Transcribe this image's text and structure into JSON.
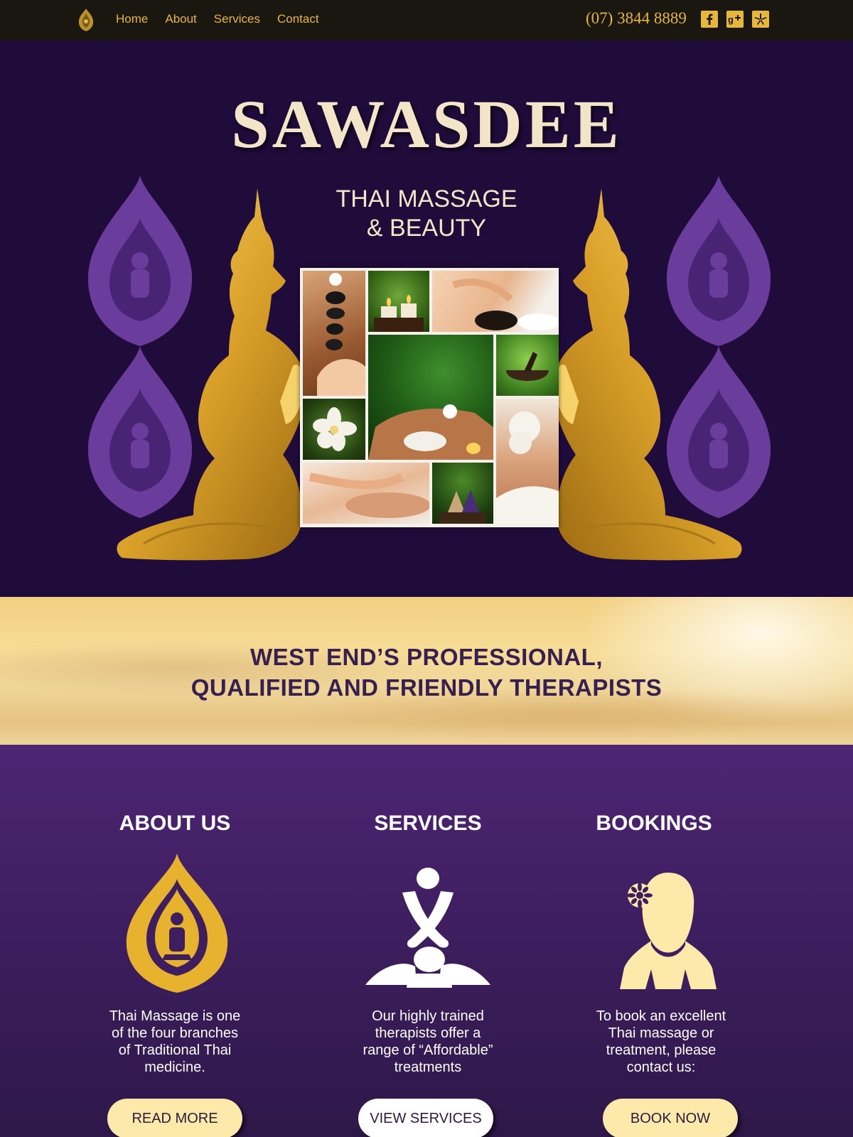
{
  "nav": {
    "links": [
      "Home",
      "About",
      "Services",
      "Contact"
    ],
    "phone": "(07) 3844 8889",
    "social_icons": [
      "facebook-icon",
      "google-plus-icon",
      "yelp-icon"
    ]
  },
  "hero": {
    "title": "SAWASDEE",
    "subtitle_line1": "THAI MASSAGE",
    "subtitle_line2": "& BEAUTY"
  },
  "banner": {
    "line1": "WEST END’S PROFESSIONAL,",
    "line2": "QUALIFIED AND FRIENDLY THERAPISTS"
  },
  "features": [
    {
      "title": "ABOUT US",
      "icon": "thai-ornament-icon",
      "text": "Thai Massage is one\nof the four branches\nof Traditional Thai\nmedicine.",
      "button": "READ MORE"
    },
    {
      "title": "SERVICES",
      "icon": "massage-icon",
      "text": "Our highly trained\ntherapists offer a\nrange of “Affordable”\ntreatments",
      "button": "VIEW SERVICES"
    },
    {
      "title": "BOOKINGS",
      "icon": "therapist-icon",
      "text": "To book an excellent\nThai massage or\ntreatment, please\ncontact us:",
      "button": "BOOK NOW"
    }
  ],
  "colors": {
    "nav_bg": "#1a1610",
    "gold": "#e7b739",
    "hero_bg": "#200c3b",
    "cream": "#f3e6c8",
    "banner_text": "#37204f",
    "button_cream": "#fde9a9",
    "button_white": "#ffffff"
  }
}
